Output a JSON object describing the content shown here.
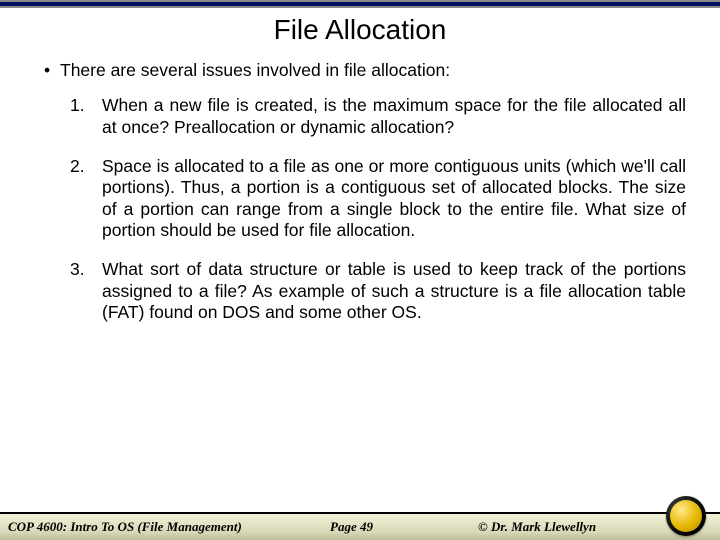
{
  "title": "File Allocation",
  "bullet_intro": "There are several issues involved in file allocation:",
  "items": [
    {
      "num": "1.",
      "text": "When a new file is created, is the maximum space for the file allocated all at once?  Preallocation or dynamic allocation?"
    },
    {
      "num": "2.",
      "text": "Space is allocated to a file as one or more contiguous units (which we'll call portions).  Thus, a portion is a contiguous set of allocated blocks.  The size of a portion can range from a single block to the entire file.  What size of portion should be used for file allocation."
    },
    {
      "num": "3.",
      "text": "What sort of data structure or table is used to keep track of the portions assigned to a file?  As example of such a structure is a file allocation table (FAT) found on DOS and some other OS."
    }
  ],
  "footer": {
    "left": "COP 4600: Intro To OS  (File Management)",
    "center": "Page 49",
    "right": "© Dr. Mark Llewellyn"
  }
}
